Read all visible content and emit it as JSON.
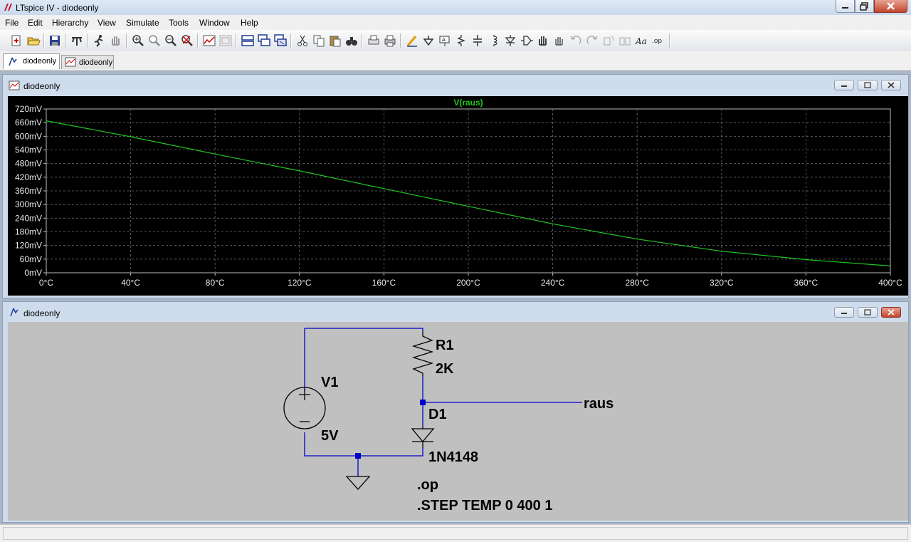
{
  "window": {
    "title": "LTspice IV - diodeonly"
  },
  "menu": [
    "File",
    "Edit",
    "Hierarchy",
    "View",
    "Simulate",
    "Tools",
    "Window",
    "Help"
  ],
  "tabs": [
    {
      "label": "diodeonly",
      "kind": "schematic"
    },
    {
      "label": "diodeonly",
      "kind": "waveform"
    }
  ],
  "waveform_window": {
    "title": "diodeonly"
  },
  "schematic_window": {
    "title": "diodeonly"
  },
  "chart_data": {
    "type": "line",
    "title": "",
    "xlabel": "",
    "ylabel": "",
    "trace_label": "V(raus)",
    "trace_color": "#22c622",
    "grid": true,
    "background": "#000000",
    "xlim": [
      0,
      400
    ],
    "ylim": [
      0,
      720
    ],
    "x_ticks": [
      "0°C",
      "40°C",
      "80°C",
      "120°C",
      "160°C",
      "200°C",
      "240°C",
      "280°C",
      "320°C",
      "360°C",
      "400°C"
    ],
    "y_ticks": [
      "720mV",
      "660mV",
      "600mV",
      "540mV",
      "480mV",
      "420mV",
      "360mV",
      "300mV",
      "240mV",
      "180mV",
      "120mV",
      "60mV",
      "0mV"
    ],
    "series": [
      {
        "name": "V(raus)",
        "x": [
          0,
          40,
          80,
          120,
          160,
          200,
          240,
          280,
          320,
          360,
          400
        ],
        "y": [
          668,
          598,
          522,
          448,
          370,
          292,
          215,
          148,
          95,
          58,
          30
        ]
      }
    ]
  },
  "schematic": {
    "v1_name": "V1",
    "v1_value": "5V",
    "r1_name": "R1",
    "r1_value": "2K",
    "d1_name": "D1",
    "d1_model": "1N4148",
    "net_label": "raus",
    "directive_op": ".op",
    "directive_step": ".STEP TEMP 0 400 1",
    "wire_color": "#0000c8"
  }
}
